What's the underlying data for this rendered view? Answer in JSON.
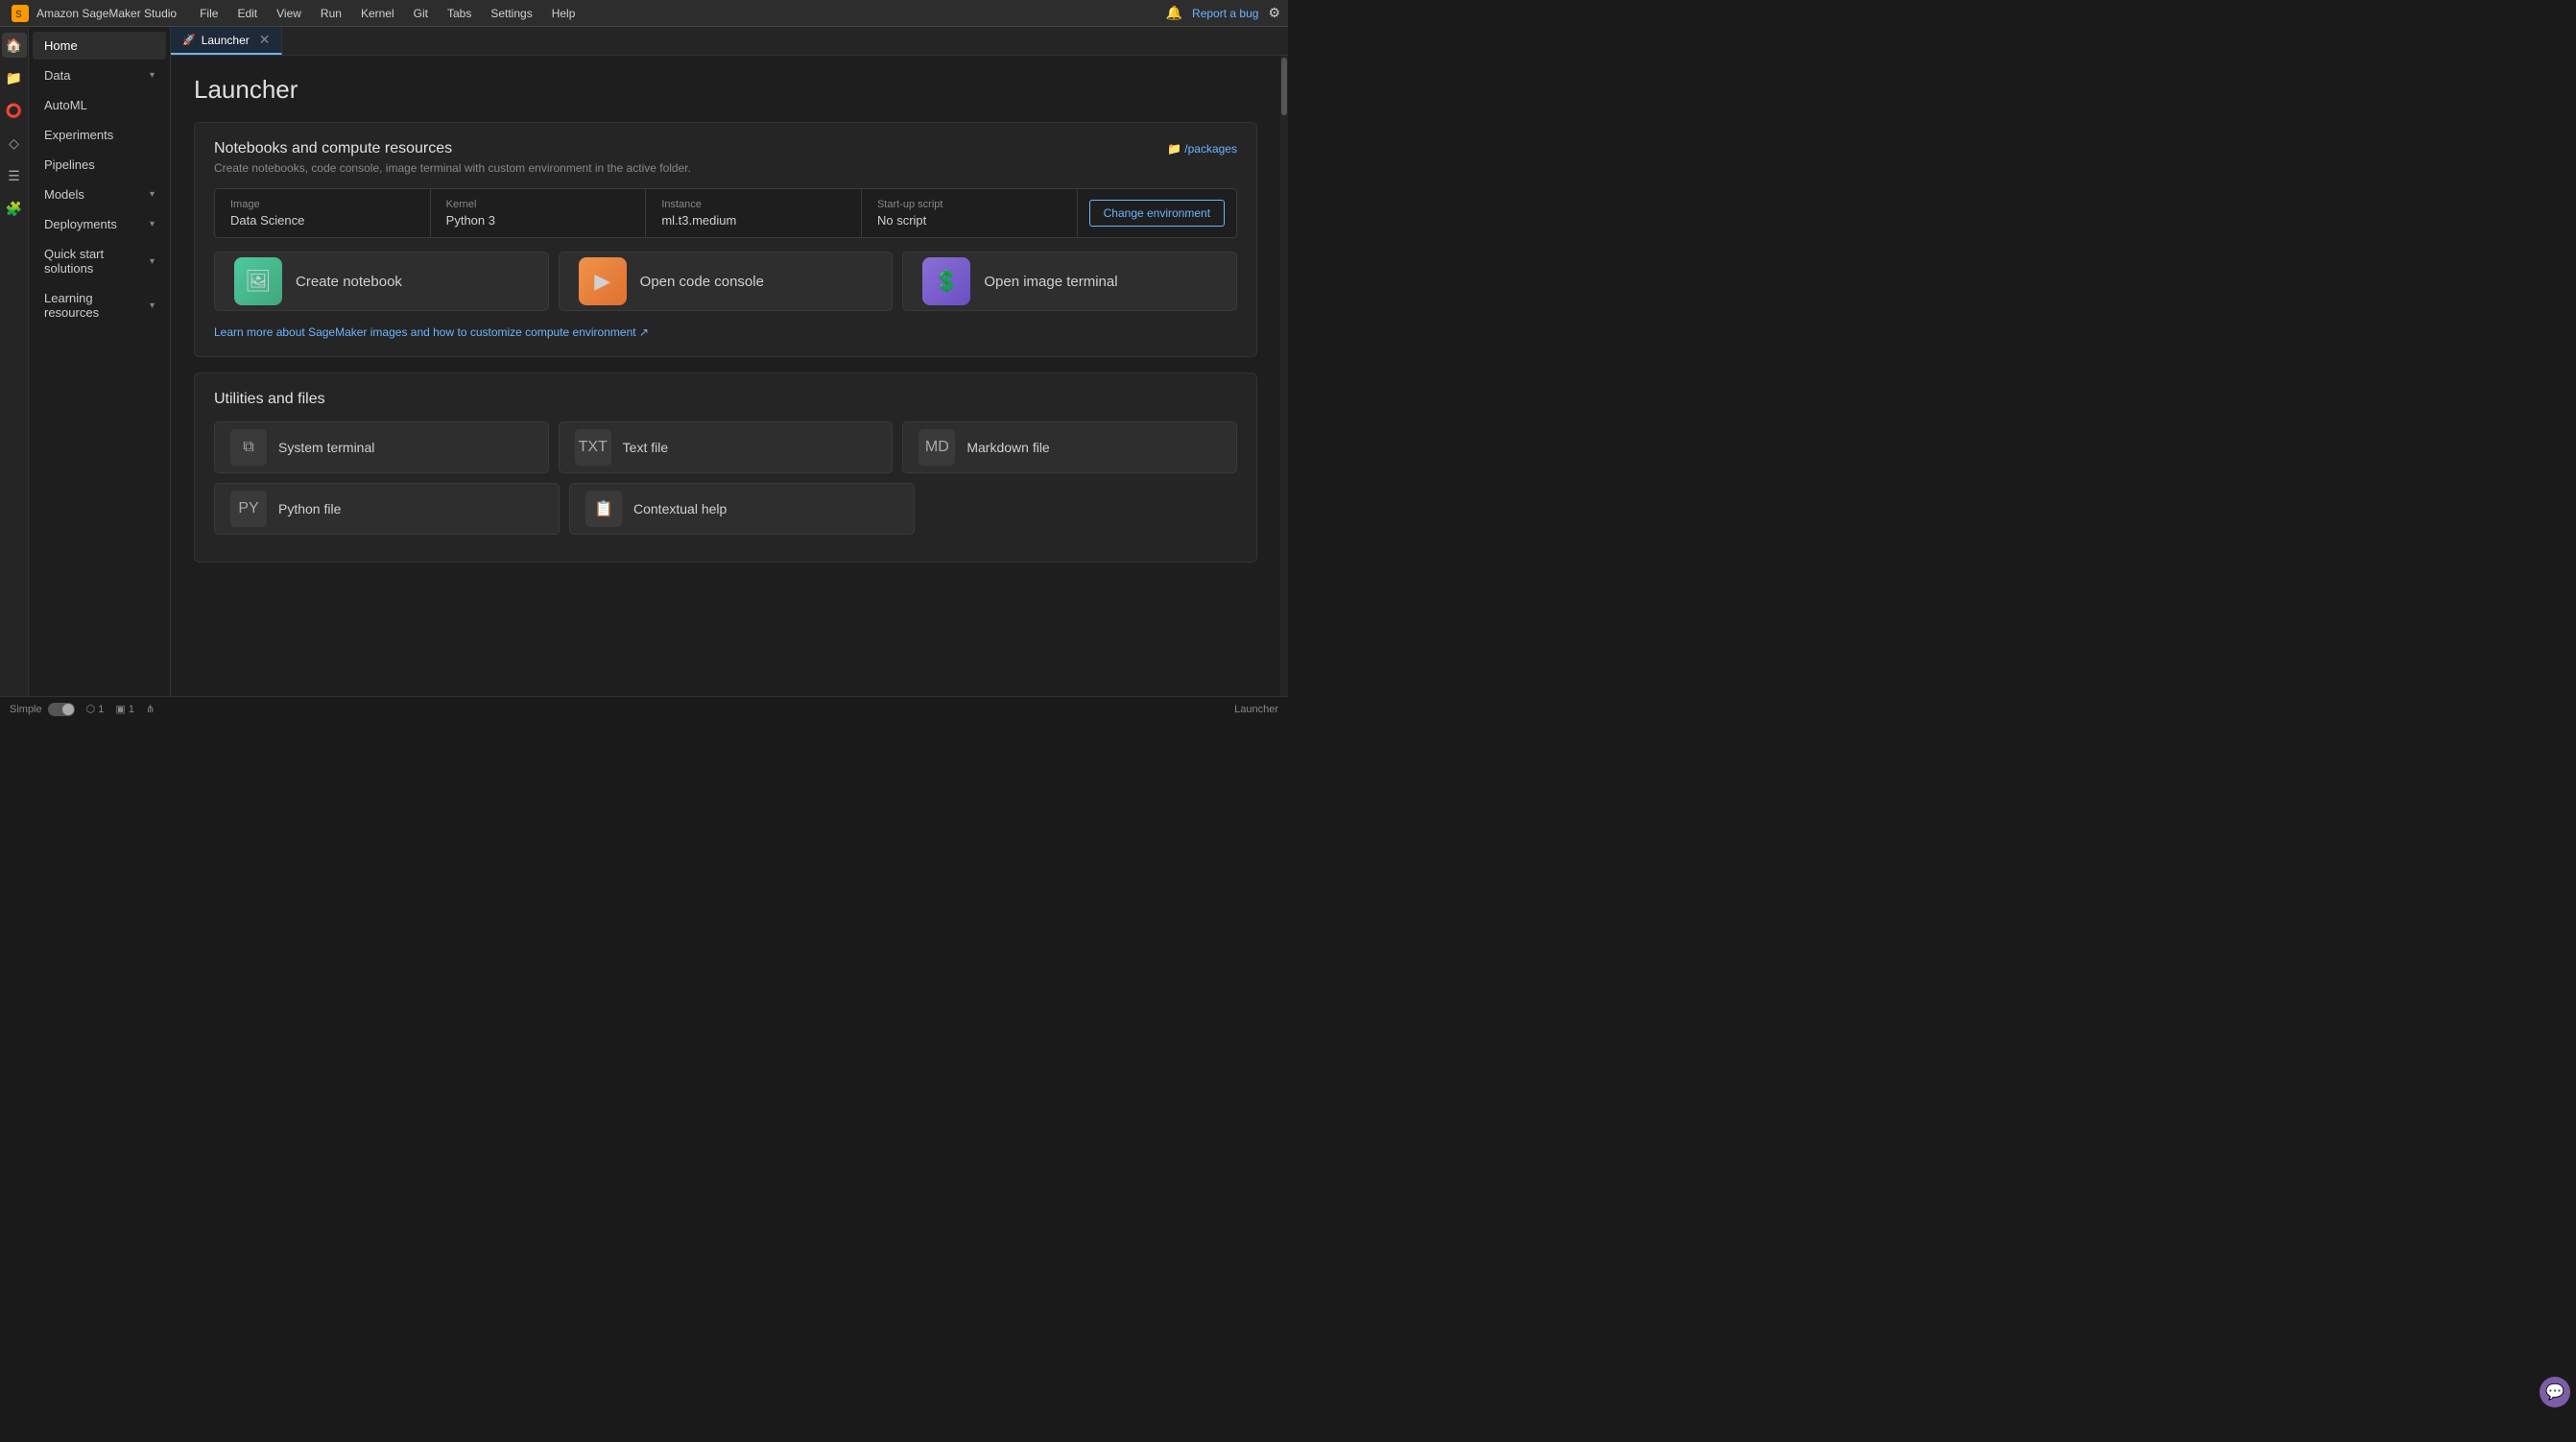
{
  "app": {
    "title": "Amazon SageMaker Studio",
    "report_bug": "Report a bug"
  },
  "menu": {
    "items": [
      "File",
      "Edit",
      "View",
      "Run",
      "Kernel",
      "Git",
      "Tabs",
      "Settings",
      "Help"
    ]
  },
  "tabs": [
    {
      "label": "Launcher",
      "icon": "🚀",
      "active": true
    }
  ],
  "page": {
    "title": "Launcher"
  },
  "sidebar": {
    "items": [
      {
        "label": "Home",
        "icon": "🏠",
        "chevron": false,
        "active": true
      },
      {
        "label": "Data",
        "icon": "📁",
        "chevron": true
      },
      {
        "label": "AutoML",
        "icon": "⭕",
        "chevron": false
      },
      {
        "label": "Experiments",
        "icon": "🔬",
        "chevron": false
      },
      {
        "label": "Pipelines",
        "icon": "◇",
        "chevron": false
      },
      {
        "label": "Models",
        "icon": "📦",
        "chevron": true
      },
      {
        "label": "Deployments",
        "icon": "🚀",
        "chevron": true
      },
      {
        "label": "Quick start solutions",
        "icon": "⬡",
        "chevron": true
      },
      {
        "label": "Learning resources",
        "icon": "📚",
        "chevron": true
      }
    ]
  },
  "notebooks_section": {
    "title": "Notebooks and compute resources",
    "subtitle": "Create notebooks, code console, image terminal with custom environment in the active folder.",
    "packages_link": "📁 /packages",
    "env": {
      "image_label": "Image",
      "image_value": "Data Science",
      "kernel_label": "Kernel",
      "kernel_value": "Python 3",
      "instance_label": "Instance",
      "instance_value": "ml.t3.medium",
      "startup_label": "Start-up script",
      "startup_value": "No script"
    },
    "change_env_btn": "Change environment",
    "tiles": [
      {
        "label": "Create notebook",
        "icon": "🖼",
        "color": "green"
      },
      {
        "label": "Open code console",
        "icon": "▶",
        "color": "orange"
      },
      {
        "label": "Open image terminal",
        "icon": "💲",
        "color": "purple"
      }
    ],
    "learn_link": "Learn more about SageMaker images and how to customize compute environment ↗"
  },
  "utilities_section": {
    "title": "Utilities and files",
    "tiles_row1": [
      {
        "label": "System terminal",
        "icon": "⧉"
      },
      {
        "label": "Text file",
        "icon": "📄"
      },
      {
        "label": "Markdown file",
        "icon": "📝"
      }
    ],
    "tiles_row2": [
      {
        "label": "Python file",
        "icon": "🐍"
      },
      {
        "label": "Contextual help",
        "icon": "📋"
      }
    ]
  },
  "status_bar": {
    "simple_label": "Simple",
    "kernel_count": "1",
    "terminal_count": "1",
    "launcher_label": "Launcher"
  }
}
